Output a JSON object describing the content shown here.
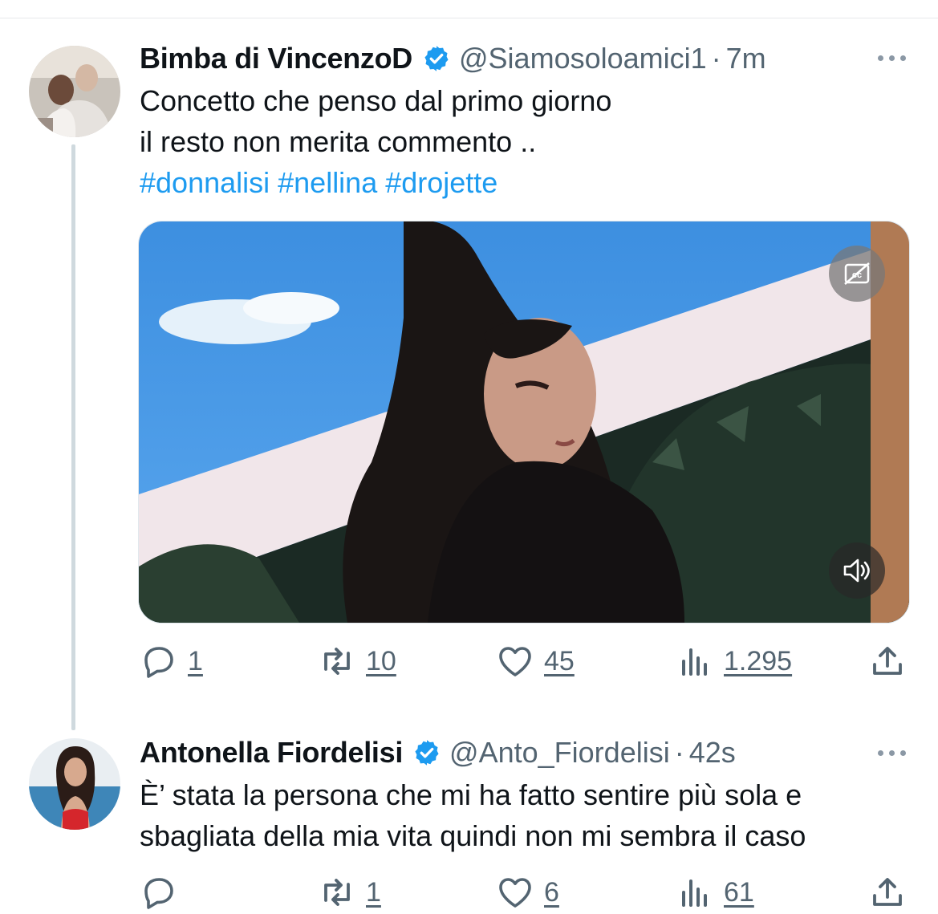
{
  "tweets": [
    {
      "name": "Bimba di VincenzoD",
      "handle": "@Siamosoloamici1",
      "sep": "·",
      "time": "7m",
      "lines": [
        "Concetto che penso dal primo giorno",
        "il resto non merita commento .."
      ],
      "hashtags": [
        "#donnalisi",
        "#nellina",
        "#drojette"
      ],
      "media": {
        "type": "video",
        "controls": [
          "captions-off-icon",
          "volume-icon"
        ]
      },
      "stats": {
        "replies": "1",
        "reposts": "10",
        "likes": "45",
        "views": "1.295"
      }
    },
    {
      "name": "Antonella Fiordelisi",
      "handle": "@Anto_Fiordelisi",
      "sep": "·",
      "time": "42s",
      "lines": [
        "È’ stata la persona che mi ha fatto sentire più sola e",
        "sbagliata della mia vita quindi non mi sembra il caso"
      ],
      "stats": {
        "replies": "",
        "reposts": "1",
        "likes": "6",
        "views": "61"
      }
    }
  ],
  "colors": {
    "accent": "#1d9bf0",
    "secondary": "#536471",
    "verified": "#1d9bf0"
  }
}
